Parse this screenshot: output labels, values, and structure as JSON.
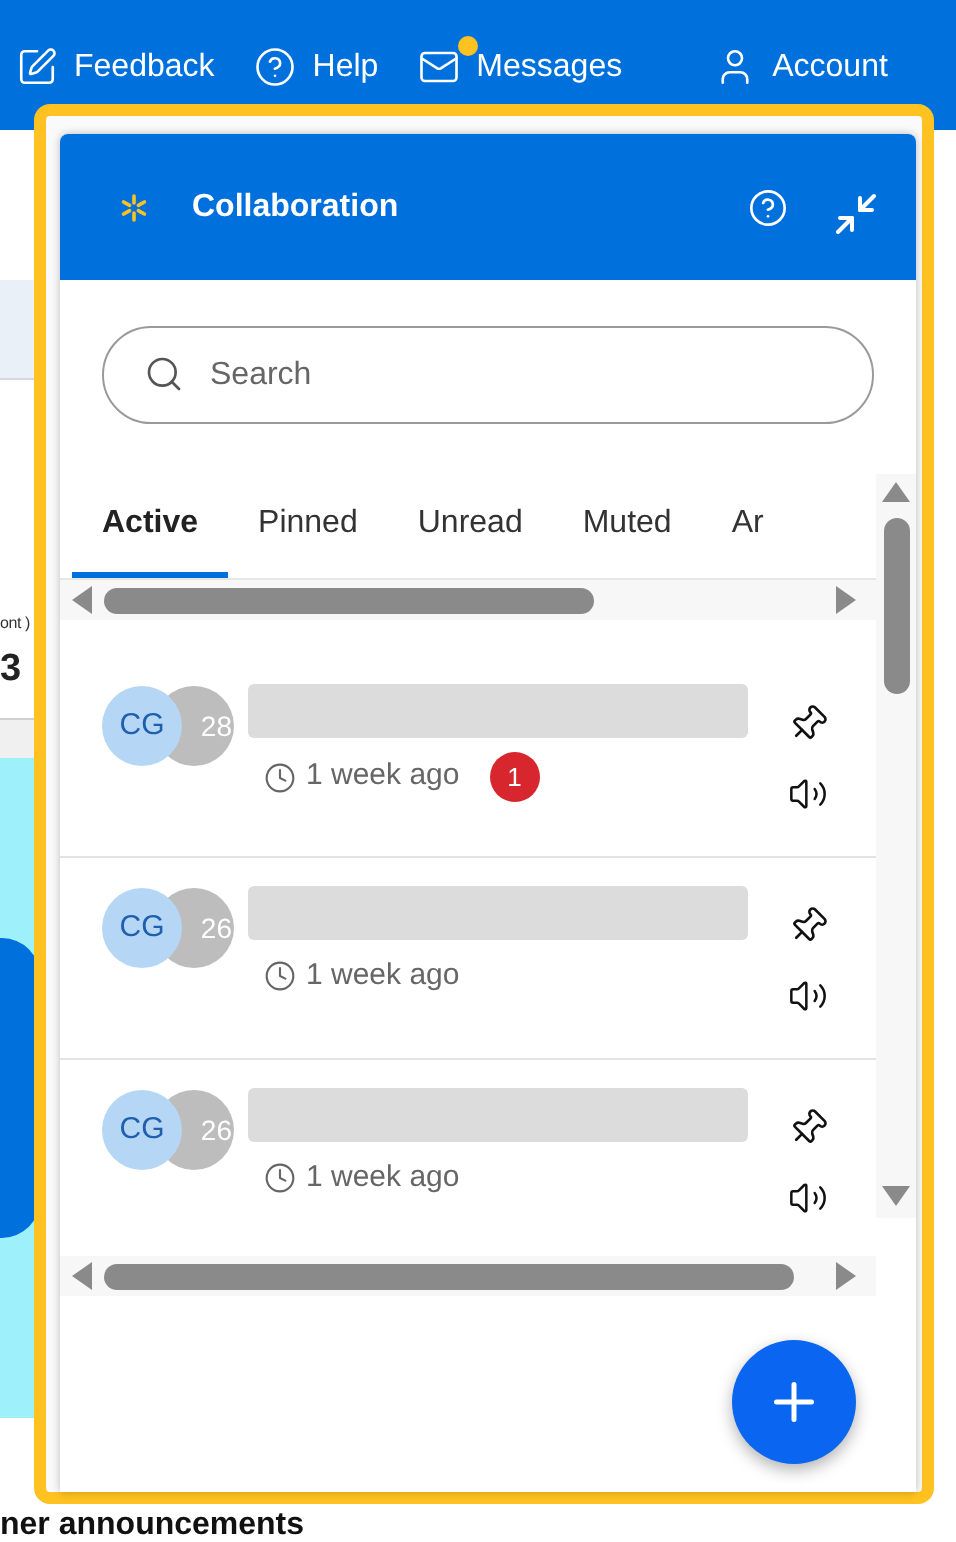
{
  "nav": [
    {
      "label": "Feedback",
      "dot": false
    },
    {
      "label": "Help",
      "dot": false
    },
    {
      "label": "Messages",
      "dot": true
    },
    {
      "label": "Account",
      "dot": false
    }
  ],
  "background": {
    "label": "ont )",
    "value": "3",
    "heading": "ner announcements"
  },
  "panel": {
    "title": "Collaboration",
    "search": {
      "placeholder": "Search"
    },
    "tabs": [
      {
        "label": "Active",
        "selected": true
      },
      {
        "label": "Pinned",
        "selected": false
      },
      {
        "label": "Unread",
        "selected": false
      },
      {
        "label": "Muted",
        "selected": false
      },
      {
        "label": "Ar",
        "selected": false
      }
    ],
    "conversations": [
      {
        "initials": "CG",
        "count": "28",
        "time": "1 week ago",
        "unread": "1"
      },
      {
        "initials": "CG",
        "count": "26",
        "time": "1 week ago"
      },
      {
        "initials": "CG",
        "count": "26",
        "time": "1 week ago"
      }
    ]
  }
}
